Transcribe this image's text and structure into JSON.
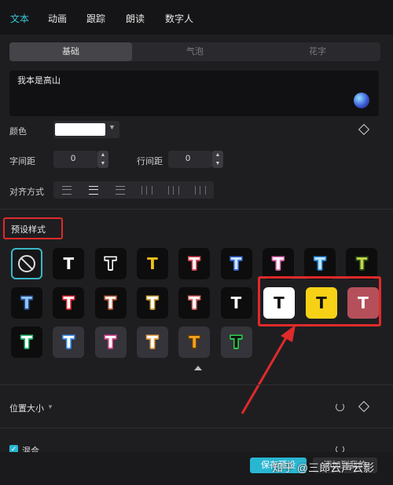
{
  "top_tabs": [
    "文本",
    "动画",
    "跟踪",
    "朗读",
    "数字人"
  ],
  "sub_tabs": [
    "基础",
    "气泡",
    "花字"
  ],
  "text_content": "我本是高山",
  "color": {
    "label": "颜色",
    "value": "#ffffff"
  },
  "letter_spacing": {
    "label": "字间距",
    "value": "0"
  },
  "line_spacing": {
    "label": "行间距",
    "value": "0"
  },
  "alignment": {
    "label": "对齐方式",
    "selected": "center"
  },
  "presets": {
    "label": "预设样式",
    "glyph": "T",
    "rows": [
      [
        {
          "kind": "none"
        },
        {
          "bg": "#0d0d0d",
          "fg": "#ffffff",
          "stroke": "#0d0d0d"
        },
        {
          "bg": "#0d0d0d",
          "fg": "#111111",
          "stroke": "#ffffff"
        },
        {
          "bg": "#0d0d0d",
          "fg": "#f2c21b",
          "stroke": "#0d0d0d"
        },
        {
          "bg": "#0d0d0d",
          "fg": "#ffffff",
          "stroke": "#e24a5a"
        },
        {
          "bg": "#0d0d0d",
          "fg": "#cfe6ff",
          "stroke": "#3a6ad9"
        },
        {
          "bg": "#0d0d0d",
          "fg": "#ffffff",
          "stroke": "#e36bb3"
        },
        {
          "bg": "#0d0d0d",
          "fg": "#bfe8ff",
          "stroke": "#2f8fe0"
        },
        {
          "bg": "#0d0d0d",
          "fg": "#c5d64a",
          "stroke": "#2a4a1a"
        }
      ],
      [
        {
          "bg": "#0d0d0d",
          "fg": "#8fc7ff",
          "stroke": "#2a4f8a"
        },
        {
          "bg": "#0d0d0d",
          "fg": "#ffffff",
          "stroke": "#e02b3a"
        },
        {
          "bg": "#0d0d0d",
          "fg": "#ffffff",
          "stroke": "#b35a3a"
        },
        {
          "bg": "#0d0d0d",
          "fg": "#ffffff",
          "stroke": "#c9a23a"
        },
        {
          "bg": "#0d0d0d",
          "fg": "#ffffff",
          "stroke": "#d96a6a"
        },
        {
          "bg": "#0d0d0d",
          "fg": "#ffffff",
          "stroke": "#0d0d0d"
        },
        {
          "bg": "#ffffff",
          "fg": "#111111",
          "stroke": "#ffffff"
        },
        {
          "bg": "#f7d116",
          "fg": "#111111",
          "stroke": "#f7d116"
        },
        {
          "bg": "#b5505a",
          "fg": "#ffffff",
          "stroke": "#b5505a"
        }
      ],
      [
        {
          "bg": "#0d0d0d",
          "fg": "#ffffff",
          "stroke": "#2bb673"
        },
        {
          "bg": "#34343a",
          "fg": "#ffffff",
          "stroke": "#3a8fe8"
        },
        {
          "bg": "#34343a",
          "fg": "#ffffff",
          "stroke": "#d9468f"
        },
        {
          "bg": "#34343a",
          "fg": "#ffffff",
          "stroke": "#e8a04a"
        },
        {
          "bg": "#34343a",
          "fg": "#f7a21b",
          "stroke": "#5a3a10"
        },
        {
          "bg": "#34343a",
          "fg": "#111111",
          "stroke": "#2bd14a"
        }
      ]
    ]
  },
  "position_size": {
    "label": "位置大小"
  },
  "blend": {
    "label": "混合",
    "checked": true
  },
  "buttons": {
    "save": "保存预设",
    "add": "添加到我的"
  },
  "watermark": "知乎 @三郎云声云影",
  "accent_color": "#29b6d1",
  "annotation_color": "#e02a2a"
}
